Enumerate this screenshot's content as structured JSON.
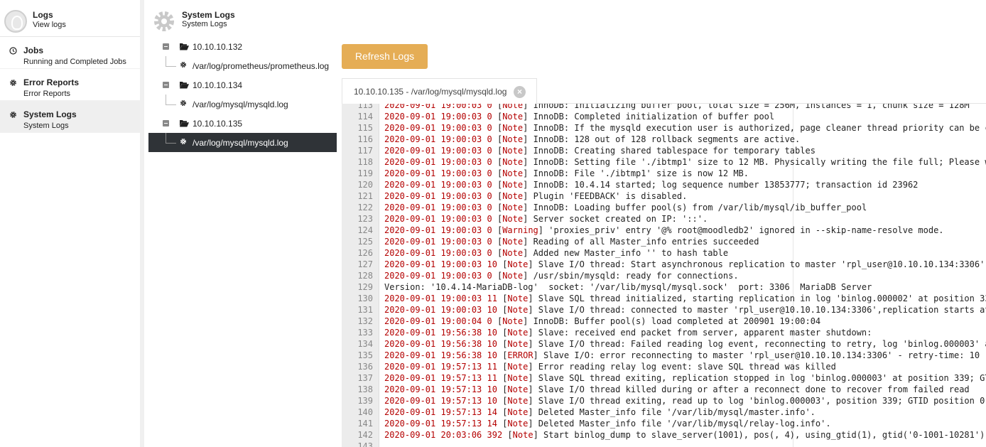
{
  "nav": {
    "app_title": "Logs",
    "app_subtitle": "View logs",
    "items": [
      {
        "label": "Jobs",
        "sub": "Running and Completed Jobs",
        "icon": "clock-icon"
      },
      {
        "label": "Error Reports",
        "sub": "Error Reports",
        "icon": "gear-icon"
      },
      {
        "label": "System Logs",
        "sub": "System Logs",
        "icon": "gear-icon",
        "active": true
      }
    ]
  },
  "tree": {
    "title": "System Logs",
    "subtitle": "System Logs",
    "hosts": [
      {
        "host": "10.10.10.132",
        "file": "/var/log/prometheus/prometheus.log"
      },
      {
        "host": "10.10.10.134",
        "file": "/var/log/mysql/mysqld.log"
      },
      {
        "host": "10.10.10.135",
        "file": "/var/log/mysql/mysqld.log",
        "active": true
      }
    ]
  },
  "main": {
    "refresh_label": "Refresh Logs",
    "tab_label": "10.10.10.135 - /var/log/mysql/mysqld.log",
    "tab_close": "×",
    "log_lines": [
      {
        "n": "113",
        "ts": "2020-09-01 19:00:03",
        "id": "0",
        "lvl": "Note",
        "msg": "InnoDB: Initializing buffer pool, total size = 256M, instances = 1, chunk size = 128M"
      },
      {
        "n": "114",
        "ts": "2020-09-01 19:00:03",
        "id": "0",
        "lvl": "Note",
        "msg": "InnoDB: Completed initialization of buffer pool"
      },
      {
        "n": "115",
        "ts": "2020-09-01 19:00:03",
        "id": "0",
        "lvl": "Note",
        "msg": "InnoDB: If the mysqld execution user is authorized, page cleaner thread priority can be c"
      },
      {
        "n": "116",
        "ts": "2020-09-01 19:00:03",
        "id": "0",
        "lvl": "Note",
        "msg": "InnoDB: 128 out of 128 rollback segments are active."
      },
      {
        "n": "117",
        "ts": "2020-09-01 19:00:03",
        "id": "0",
        "lvl": "Note",
        "msg": "InnoDB: Creating shared tablespace for temporary tables"
      },
      {
        "n": "118",
        "ts": "2020-09-01 19:00:03",
        "id": "0",
        "lvl": "Note",
        "msg": "InnoDB: Setting file './ibtmp1' size to 12 MB. Physically writing the file full; Please w"
      },
      {
        "n": "119",
        "ts": "2020-09-01 19:00:03",
        "id": "0",
        "lvl": "Note",
        "msg": "InnoDB: File './ibtmp1' size is now 12 MB."
      },
      {
        "n": "120",
        "ts": "2020-09-01 19:00:03",
        "id": "0",
        "lvl": "Note",
        "msg": "InnoDB: 10.4.14 started; log sequence number 13853777; transaction id 23962"
      },
      {
        "n": "121",
        "ts": "2020-09-01 19:00:03",
        "id": "0",
        "lvl": "Note",
        "msg": "Plugin 'FEEDBACK' is disabled."
      },
      {
        "n": "122",
        "ts": "2020-09-01 19:00:03",
        "id": "0",
        "lvl": "Note",
        "msg": "InnoDB: Loading buffer pool(s) from /var/lib/mysql/ib_buffer_pool"
      },
      {
        "n": "123",
        "ts": "2020-09-01 19:00:03",
        "id": "0",
        "lvl": "Note",
        "msg": "Server socket created on IP: '::'."
      },
      {
        "n": "124",
        "ts": "2020-09-01 19:00:03",
        "id": "0",
        "lvl": "Warning",
        "msg": "'proxies_priv' entry '@% root@moodledb2' ignored in --skip-name-resolve mode."
      },
      {
        "n": "125",
        "ts": "2020-09-01 19:00:03",
        "id": "0",
        "lvl": "Note",
        "msg": "Reading of all Master_info entries succeeded"
      },
      {
        "n": "126",
        "ts": "2020-09-01 19:00:03",
        "id": "0",
        "lvl": "Note",
        "msg": "Added new Master_info '' to hash table"
      },
      {
        "n": "127",
        "ts": "2020-09-01 19:00:03",
        "id": "10",
        "lvl": "Note",
        "msg": "Slave I/O thread: Start asynchronous replication to master 'rpl_user@10.10.10.134:3306'"
      },
      {
        "n": "128",
        "ts": "2020-09-01 19:00:03",
        "id": "0",
        "lvl": "Note",
        "msg": "/usr/sbin/mysqld: ready for connections."
      },
      {
        "n": "129",
        "plain": "Version: '10.4.14-MariaDB-log'  socket: '/var/lib/mysql/mysql.sock'  port: 3306  MariaDB Server"
      },
      {
        "n": "130",
        "ts": "2020-09-01 19:00:03",
        "id": "11",
        "lvl": "Note",
        "msg": "Slave SQL thread initialized, starting replication in log 'binlog.000002' at position 33"
      },
      {
        "n": "131",
        "ts": "2020-09-01 19:00:03",
        "id": "10",
        "lvl": "Note",
        "msg": "Slave I/O thread: connected to master 'rpl_user@10.10.10.134:3306',replication starts at"
      },
      {
        "n": "132",
        "ts": "2020-09-01 19:00:04",
        "id": "0",
        "lvl": "Note",
        "msg": "InnoDB: Buffer pool(s) load completed at 200901 19:00:04"
      },
      {
        "n": "133",
        "ts": "2020-09-01 19:56:38",
        "id": "10",
        "lvl": "Note",
        "msg": "Slave: received end packet from server, apparent master shutdown:"
      },
      {
        "n": "134",
        "ts": "2020-09-01 19:56:38",
        "id": "10",
        "lvl": "Note",
        "msg": "Slave I/O thread: Failed reading log event, reconnecting to retry, log 'binlog.000003' a"
      },
      {
        "n": "135",
        "ts": "2020-09-01 19:56:38",
        "id": "10",
        "lvl": "ERROR",
        "msg": "Slave I/O: error reconnecting to master 'rpl_user@10.10.10.134:3306' - retry-time: 10"
      },
      {
        "n": "136",
        "ts": "2020-09-01 19:57:13",
        "id": "11",
        "lvl": "Note",
        "msg": "Error reading relay log event: slave SQL thread was killed"
      },
      {
        "n": "137",
        "ts": "2020-09-01 19:57:13",
        "id": "11",
        "lvl": "Note",
        "msg": "Slave SQL thread exiting, replication stopped in log 'binlog.000003' at position 339; GT"
      },
      {
        "n": "138",
        "ts": "2020-09-01 19:57:13",
        "id": "10",
        "lvl": "Note",
        "msg": "Slave I/O thread killed during or after a reconnect done to recover from failed read"
      },
      {
        "n": "139",
        "ts": "2020-09-01 19:57:13",
        "id": "10",
        "lvl": "Note",
        "msg": "Slave I/O thread exiting, read up to log 'binlog.000003', position 339; GTID position 0-"
      },
      {
        "n": "140",
        "ts": "2020-09-01 19:57:13",
        "id": "14",
        "lvl": "Note",
        "msg": "Deleted Master_info file '/var/lib/mysql/master.info'."
      },
      {
        "n": "141",
        "ts": "2020-09-01 19:57:13",
        "id": "14",
        "lvl": "Note",
        "msg": "Deleted Master_info file '/var/lib/mysql/relay-log.info'."
      },
      {
        "n": "142",
        "ts": "2020-09-01 20:03:06",
        "id": "392",
        "lvl": "Note",
        "msg": "Start binlog_dump to slave_server(1001), pos(, 4), using_gtid(1), gtid('0-1001-10281')"
      },
      {
        "n": "143",
        "plain": ""
      }
    ]
  },
  "colors": {
    "accent": "#e5ad55",
    "active_row": "#2f3337",
    "log_red": "#b40000"
  }
}
